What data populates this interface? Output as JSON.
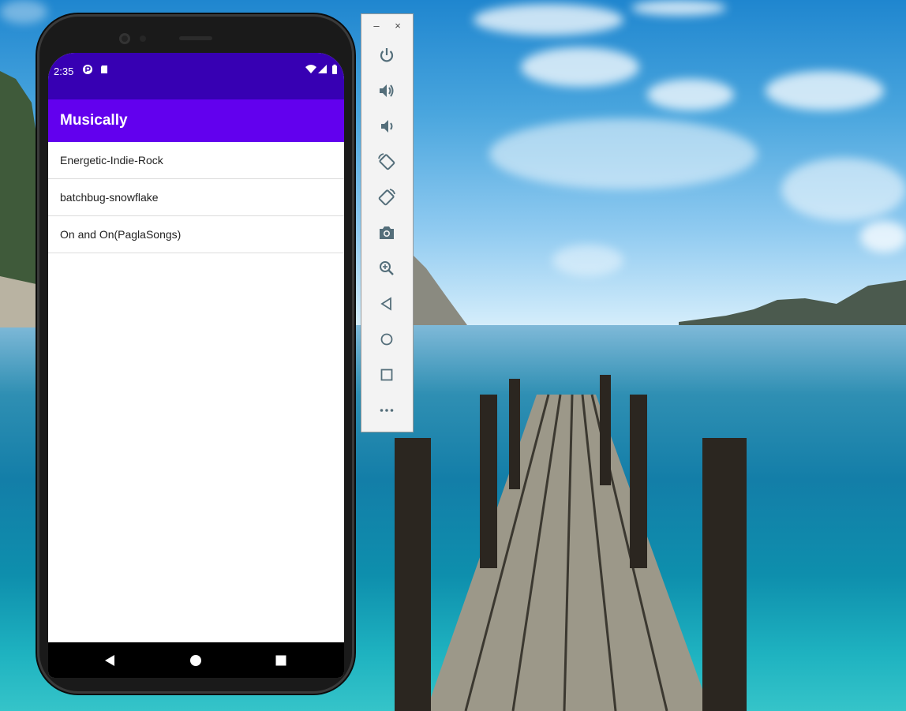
{
  "status_bar": {
    "time": "2:35",
    "icons": [
      "app-notification-icon",
      "sd-card-icon",
      "wifi-icon",
      "cell-signal-icon",
      "battery-icon"
    ]
  },
  "app_bar": {
    "title": "Musically"
  },
  "songs": [
    {
      "label": "Energetic-Indie-Rock"
    },
    {
      "label": "batchbug-snowflake"
    },
    {
      "label": "On and On(PaglaSongs)"
    }
  ],
  "nav_bar": {
    "buttons": [
      "back-icon",
      "home-icon",
      "recents-icon"
    ]
  },
  "emulator_toolbar": {
    "window_controls": {
      "minimize": "–",
      "close": "×"
    },
    "buttons": [
      "power-icon",
      "volume-up-icon",
      "volume-down-icon",
      "rotate-left-icon",
      "rotate-right-icon",
      "screenshot-icon",
      "zoom-icon",
      "back-icon",
      "home-icon",
      "overview-icon",
      "more-icon"
    ]
  },
  "colors": {
    "status_bar": "#3700b3",
    "app_bar": "#6200ee",
    "toolbar_icon": "#546e7a"
  }
}
